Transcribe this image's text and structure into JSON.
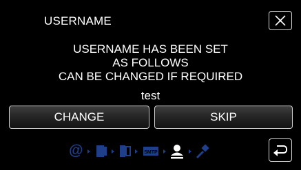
{
  "dialog": {
    "title": "USERNAME",
    "message_lines": [
      "USERNAME HAS BEEN SET",
      "AS FOLLOWS",
      "CAN BE CHANGED IF REQUIRED"
    ],
    "username_value": "test"
  },
  "buttons": {
    "change_label": "CHANGE",
    "skip_label": "SKIP"
  },
  "icons": {
    "close": "close-icon",
    "back": "return-icon"
  },
  "steps": {
    "items": [
      {
        "icon": "at-icon",
        "state": "done"
      },
      {
        "icon": "device-icon",
        "state": "done"
      },
      {
        "icon": "device-open-icon",
        "state": "done"
      },
      {
        "icon": "smtp-icon",
        "state": "done"
      },
      {
        "icon": "user-icon",
        "state": "current"
      },
      {
        "icon": "settings-icon",
        "state": "pending"
      }
    ],
    "colors": {
      "done": "#1f3f8a",
      "current": "#ffffff",
      "pending": "#1f3f8a"
    }
  }
}
